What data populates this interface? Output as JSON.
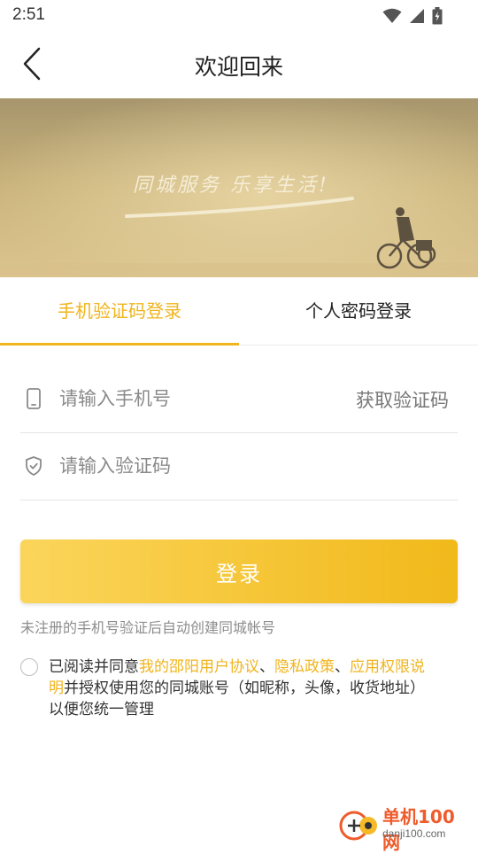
{
  "status_bar": {
    "time": "2:51"
  },
  "header": {
    "title": "欢迎回来"
  },
  "banner": {
    "slogan": "同城服务  乐享生活!"
  },
  "tabs": [
    {
      "label": "手机验证码登录",
      "active": true
    },
    {
      "label": "个人密码登录",
      "active": false
    }
  ],
  "form": {
    "phone_placeholder": "请输入手机号",
    "get_code_label": "获取验证码",
    "code_placeholder": "请输入验证码"
  },
  "login_button": {
    "label": "登录"
  },
  "hint": "未注册的手机号验证后自动创建同城帐号",
  "agreement": {
    "checked": false,
    "prefix": "已阅读并同意",
    "link1": "我的邵阳用户协议",
    "sep1": "、",
    "link2": "隐私政策",
    "sep2": "、",
    "link3": "应用权限说明",
    "suffix": "并授权使用您的同城账号（如昵称，头像，收货地址）以便您统一管理"
  },
  "watermark": {
    "text": "单机100网",
    "url": "danji100.com"
  },
  "colors": {
    "accent": "#f0b41d",
    "banner_tone": "#c9b27a"
  }
}
